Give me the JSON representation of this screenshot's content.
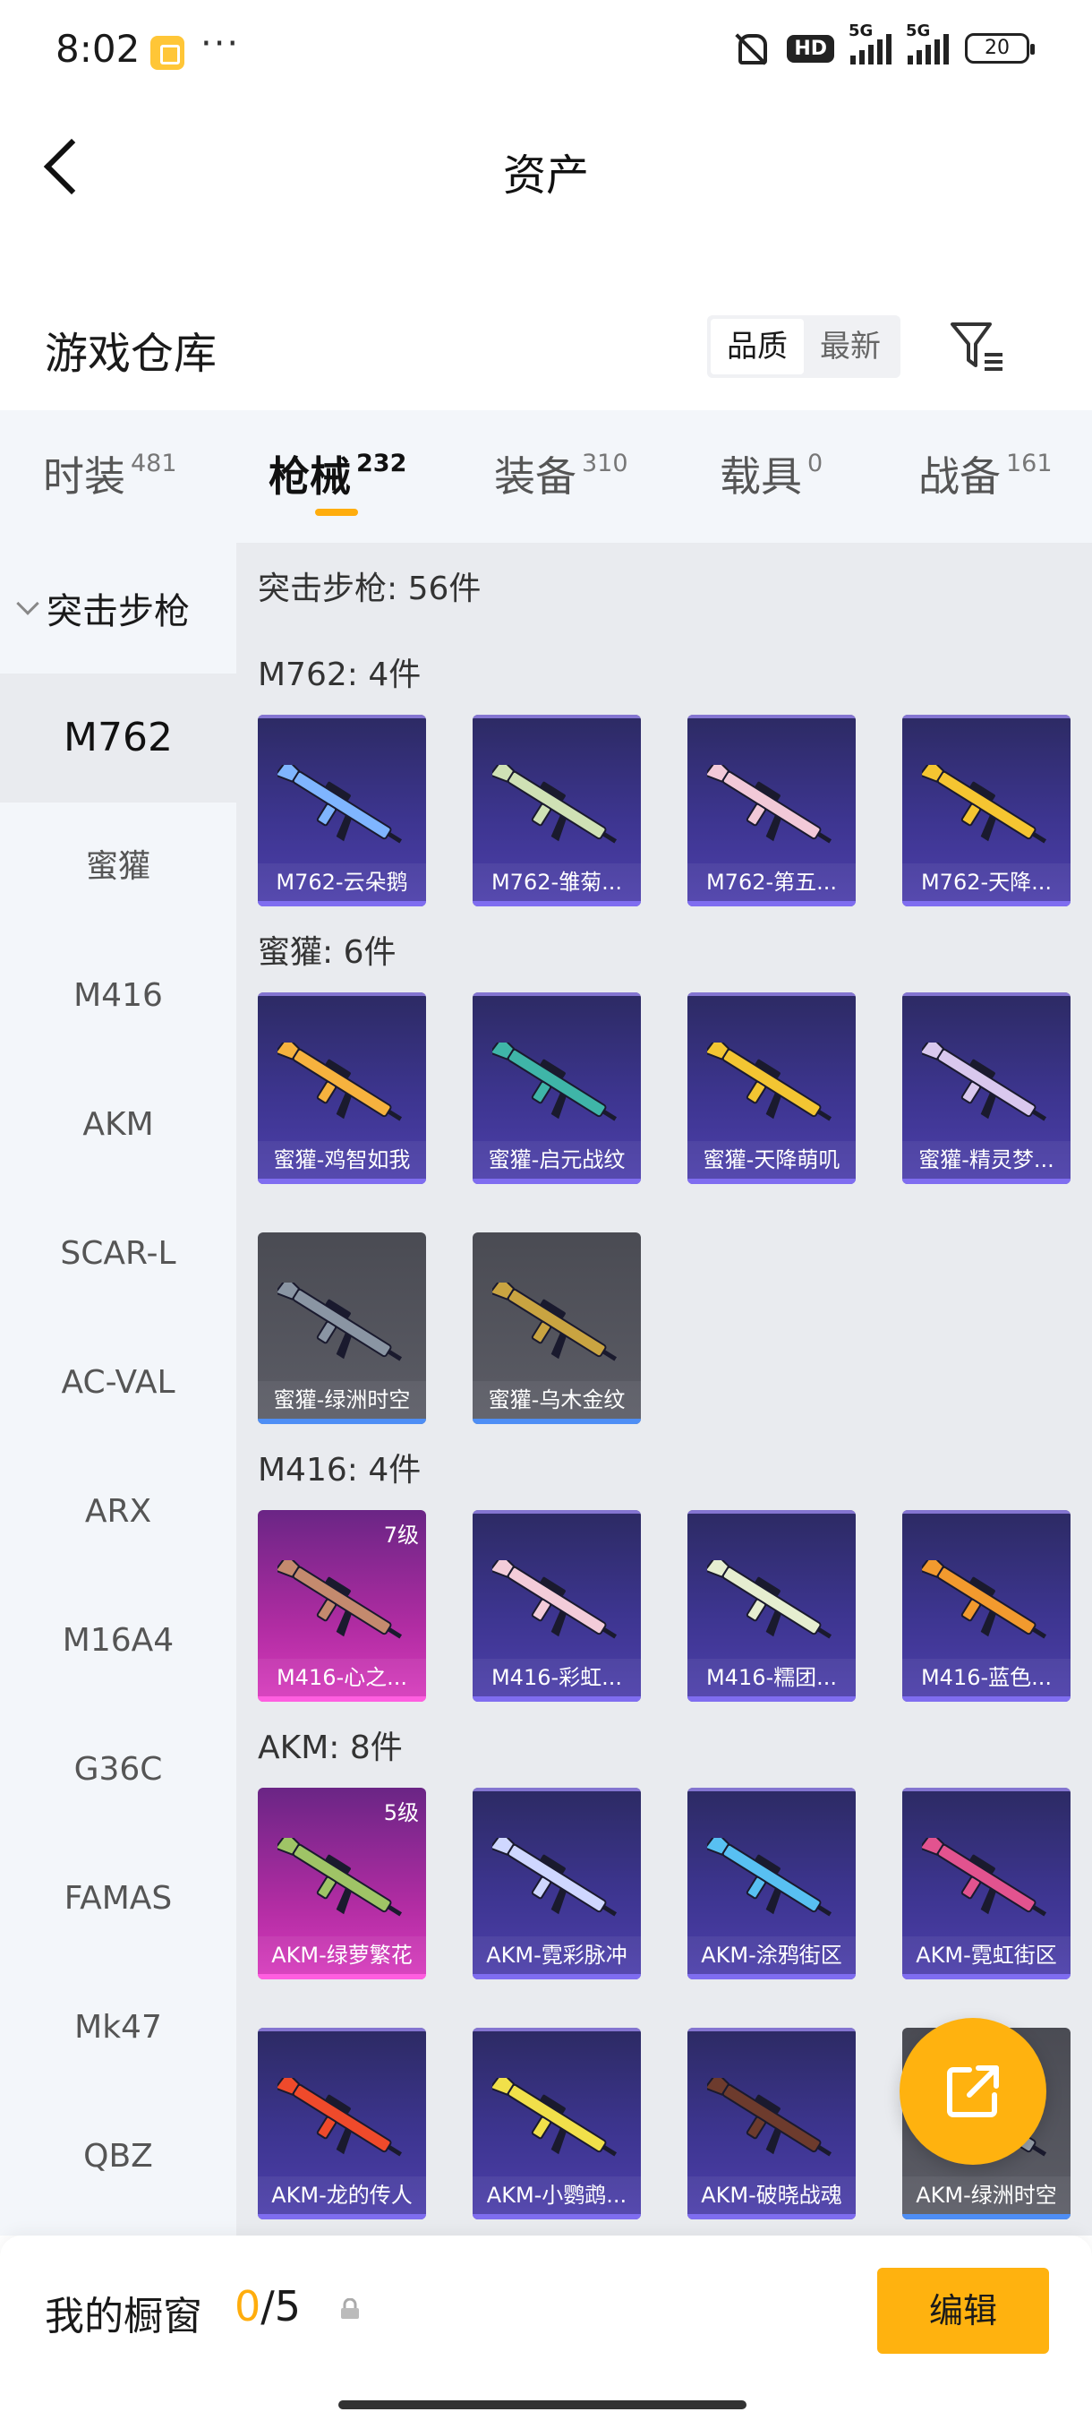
{
  "status_bar": {
    "time": "8:02",
    "dots": "···",
    "hd": "HD",
    "net1": "5G",
    "net2": "5G",
    "battery": "20"
  },
  "header": {
    "title": "资产"
  },
  "warehouse": {
    "title": "游戏仓库",
    "sort_options": [
      "品质",
      "最新"
    ],
    "sort_selected": "品质"
  },
  "tabs": [
    {
      "label": "时装",
      "count": "481"
    },
    {
      "label": "枪械",
      "count": "232"
    },
    {
      "label": "装备",
      "count": "310"
    },
    {
      "label": "载具",
      "count": "0"
    },
    {
      "label": "战备",
      "count": "161"
    }
  ],
  "active_tab": "枪械",
  "sidebar": {
    "category": "突击步枪",
    "items": [
      "M762",
      "蜜獾",
      "M416",
      "AKM",
      "SCAR-L",
      "AC-VAL",
      "ARX",
      "M16A4",
      "G36C",
      "FAMAS",
      "Mk47",
      "QBZ"
    ],
    "active": "M762"
  },
  "main": {
    "summary": "突击步枪: 56件",
    "groups": [
      {
        "title": "M762: 4件",
        "items": [
          {
            "name": "M762-云朵鹅",
            "rarity": "purple",
            "gun_color": "#7fb5ff"
          },
          {
            "name": "M762-雏菊...",
            "rarity": "purple",
            "gun_color": "#cfe1b5"
          },
          {
            "name": "M762-第五...",
            "rarity": "purple",
            "gun_color": "#f2c9d8"
          },
          {
            "name": "M762-天降...",
            "rarity": "purple",
            "gun_color": "#f5c531"
          }
        ]
      },
      {
        "title": "蜜獾: 6件",
        "items": [
          {
            "name": "蜜獾-鸡智如我",
            "rarity": "purple",
            "gun_color": "#f6b23e"
          },
          {
            "name": "蜜獾-启元战纹",
            "rarity": "purple",
            "gun_color": "#3fb5a8"
          },
          {
            "name": "蜜獾-天降萌叽",
            "rarity": "purple",
            "gun_color": "#f3c532"
          },
          {
            "name": "蜜獾-精灵梦...",
            "rarity": "purple",
            "gun_color": "#d9c8ee"
          },
          {
            "name": "蜜獾-绿洲时空",
            "rarity": "gray",
            "gun_color": "#8a95a3"
          },
          {
            "name": "蜜獾-乌木金纹",
            "rarity": "gray",
            "gun_color": "#c9a441"
          }
        ]
      },
      {
        "title": "M416: 4件",
        "items": [
          {
            "name": "M416-心之...",
            "rarity": "pink",
            "level": "7级",
            "gun_color": "#c48a6e"
          },
          {
            "name": "M416-彩虹...",
            "rarity": "purple",
            "gun_color": "#f3ccd9"
          },
          {
            "name": "M416-糯团...",
            "rarity": "purple",
            "gun_color": "#e6eed0"
          },
          {
            "name": "M416-蓝色...",
            "rarity": "purple",
            "gun_color": "#f29a2e"
          }
        ]
      },
      {
        "title": "AKM: 8件",
        "items": [
          {
            "name": "AKM-绿萝繁花",
            "rarity": "pink",
            "level": "5级",
            "gun_color": "#9fc466"
          },
          {
            "name": "AKM-霓彩脉冲",
            "rarity": "purple",
            "gun_color": "#cfd7ff"
          },
          {
            "name": "AKM-涂鸦街区",
            "rarity": "purple",
            "gun_color": "#58c0f2"
          },
          {
            "name": "AKM-霓虹街区",
            "rarity": "purple",
            "gun_color": "#e2538f"
          },
          {
            "name": "AKM-龙的传人",
            "rarity": "purple",
            "gun_color": "#ef4a2b"
          },
          {
            "name": "AKM-小鹦鹉...",
            "rarity": "purple",
            "gun_color": "#f1e04a"
          },
          {
            "name": "AKM-破晓战魂",
            "rarity": "purple",
            "gun_color": "#6d3b2d"
          },
          {
            "name": "AKM-绿洲时空",
            "rarity": "gray",
            "gun_color": "#9aa3ad"
          }
        ]
      }
    ]
  },
  "bottom_bar": {
    "label": "我的橱窗",
    "current": "0",
    "separator": "/",
    "max": "5",
    "edit_label": "编辑"
  }
}
